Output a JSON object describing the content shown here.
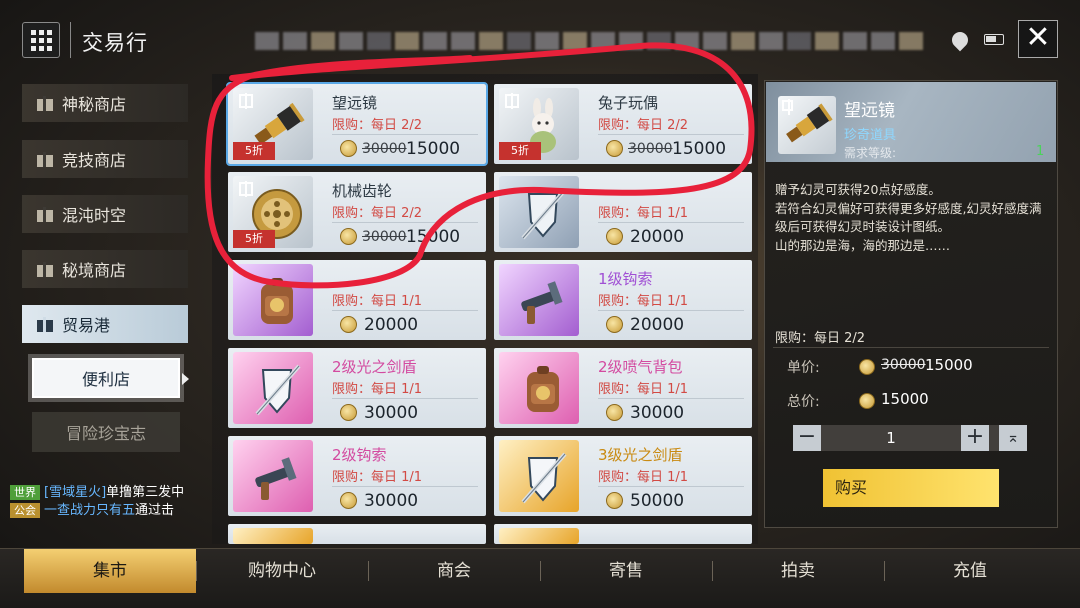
{
  "header": {
    "title": "交易行",
    "menu_icon": "grid-menu-icon",
    "close_icon": "close-x-icon"
  },
  "shops": [
    {
      "label": "神秘商店",
      "icon": "gift-icon"
    },
    {
      "label": "竞技商店",
      "icon": "gift-icon"
    },
    {
      "label": "混沌时空",
      "icon": "gift-icon"
    },
    {
      "label": "秘境商店",
      "icon": "gift-icon"
    },
    {
      "label": "贸易港",
      "icon": "gift-icon",
      "active": true
    }
  ],
  "subshops": [
    {
      "label": "便利店",
      "selected": true
    },
    {
      "label": "冒险珍宝志",
      "selected": false
    }
  ],
  "chat": {
    "line1": {
      "channel": "世界",
      "user": "[雪域星火]",
      "text": "单撸第三发中"
    },
    "line2": {
      "channel": "公会",
      "user": "一查战力只有五",
      "text": "通过击"
    }
  },
  "items": [
    {
      "name": "望远镜",
      "limit": "限购：每日 2/2",
      "old_price": "30000",
      "price": "15000",
      "discount": "5折",
      "quality": "grey",
      "icon": "telescope-icon"
    },
    {
      "name": "兔子玩偶",
      "limit": "限购：每日 2/2",
      "old_price": "30000",
      "price": "15000",
      "discount": "5折",
      "quality": "grey",
      "icon": "rabbit-doll-icon"
    },
    {
      "name": "机械齿轮",
      "limit": "限购：每日 2/2",
      "old_price": "30000",
      "price": "15000",
      "discount": "5折",
      "quality": "grey",
      "icon": "gear-icon"
    },
    {
      "name": "",
      "limit": "限购：每日 1/1",
      "old_price": "",
      "price": "20000",
      "discount": "",
      "quality": "blue",
      "icon": "shield-sword-icon"
    },
    {
      "name": "",
      "limit": "限购：每日 1/1",
      "old_price": "",
      "price": "20000",
      "discount": "",
      "quality": "purple",
      "icon": "backpack-icon"
    },
    {
      "name": "1级钩索",
      "limit": "限购：每日 1/1",
      "old_price": "",
      "price": "20000",
      "discount": "",
      "quality": "purple",
      "icon": "grappling-hook-icon"
    },
    {
      "name": "2级光之剑盾",
      "limit": "限购：每日 1/1",
      "old_price": "",
      "price": "30000",
      "discount": "",
      "quality": "pink",
      "icon": "shield-sword-icon"
    },
    {
      "name": "2级喷气背包",
      "limit": "限购：每日 1/1",
      "old_price": "",
      "price": "30000",
      "discount": "",
      "quality": "pink",
      "icon": "backpack-icon"
    },
    {
      "name": "2级钩索",
      "limit": "限购：每日 1/1",
      "old_price": "",
      "price": "30000",
      "discount": "",
      "quality": "pink",
      "icon": "grappling-hook-icon"
    },
    {
      "name": "3级光之剑盾",
      "limit": "限购：每日 1/1",
      "old_price": "",
      "price": "50000",
      "discount": "",
      "quality": "gold",
      "icon": "shield-sword-icon"
    }
  ],
  "detail": {
    "name": "望远镜",
    "type": "珍奇道具",
    "level_label": "需求等级:",
    "level_value": "1",
    "desc1": "赠予幻灵可获得20点好感度。",
    "desc2": "若符合幻灵偏好可获得更多好感度,幻灵好感度满级后可获得幻灵时装设计图纸。",
    "desc3": "山的那边是海，海的那边是……",
    "limit": "限购：每日 2/2",
    "unit_label": "单价:",
    "unit_old": "30000",
    "unit_price": "15000",
    "total_label": "总价:",
    "total_price": "15000",
    "quantity": "1",
    "minus": "−",
    "plus": "+",
    "max": "⌅",
    "buy_label": "购买"
  },
  "tabs": [
    {
      "label": "集市",
      "active": true
    },
    {
      "label": "购物中心"
    },
    {
      "label": "商会"
    },
    {
      "label": "寄售"
    },
    {
      "label": "拍卖"
    },
    {
      "label": "充值"
    }
  ],
  "colors": {
    "discount_red": "#c5322e",
    "limit_red": "#d24a44",
    "buy_yellow": "#f0c233",
    "active_tab": "#f4cf72",
    "annotation_red": "#e8213a"
  }
}
